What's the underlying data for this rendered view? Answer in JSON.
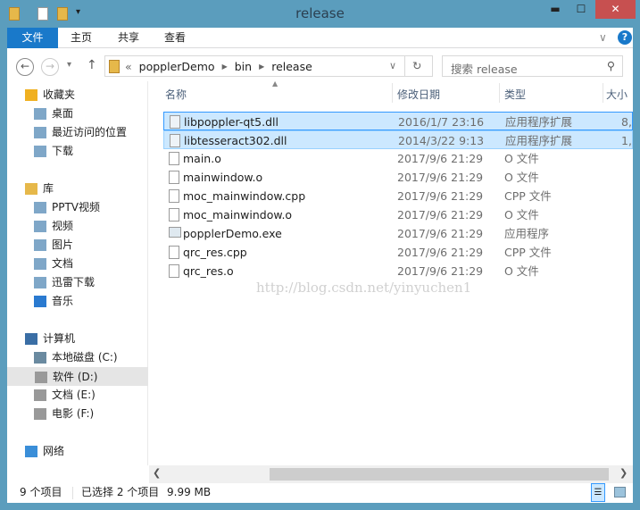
{
  "window": {
    "title": "release",
    "minimize": "▬",
    "maximize": "☐",
    "close": "✕"
  },
  "ribbon": {
    "tabs": [
      "文件",
      "主页",
      "共享",
      "查看"
    ],
    "expand": "∨",
    "help": "?"
  },
  "address": {
    "back": "←",
    "forward": "→",
    "recent": "▾",
    "up": "↑",
    "overflow": "«",
    "crumbs": [
      "popplerDemo",
      "bin",
      "release"
    ],
    "dropdown": "∨",
    "refresh": "↻"
  },
  "search": {
    "placeholder": "搜索 release",
    "icon": "search-icon"
  },
  "nav": [
    {
      "label": "收藏夹",
      "icon": "star-icon",
      "level": 0
    },
    {
      "label": "桌面",
      "icon": "desktop-icon",
      "level": 1
    },
    {
      "label": "最近访问的位置",
      "icon": "recent-places-icon",
      "level": 1
    },
    {
      "label": "下载",
      "icon": "downloads-folder-icon",
      "level": 1
    },
    {
      "label": "库",
      "icon": "library-icon",
      "level": 0
    },
    {
      "label": "PPTV视频",
      "icon": "library-video-icon",
      "level": 1
    },
    {
      "label": "视频",
      "icon": "video-icon",
      "level": 1
    },
    {
      "label": "图片",
      "icon": "pictures-icon",
      "level": 1
    },
    {
      "label": "文档",
      "icon": "documents-icon",
      "level": 1
    },
    {
      "label": "迅雷下载",
      "icon": "library-downloads-icon",
      "level": 1
    },
    {
      "label": "音乐",
      "icon": "music-icon",
      "level": 1
    },
    {
      "label": "计算机",
      "icon": "computer-icon",
      "level": 0
    },
    {
      "label": "本地磁盘 (C:)",
      "icon": "system-drive-icon",
      "level": 1
    },
    {
      "label": "软件 (D:)",
      "icon": "drive-icon",
      "level": 1,
      "selected": true
    },
    {
      "label": "文档 (E:)",
      "icon": "drive-icon",
      "level": 1
    },
    {
      "label": "电影 (F:)",
      "icon": "drive-icon",
      "level": 1
    },
    {
      "label": "网络",
      "icon": "network-icon",
      "level": 0
    }
  ],
  "columns": [
    "名称",
    "修改日期",
    "类型",
    "大小"
  ],
  "files": [
    {
      "name": "libpoppler-qt5.dll",
      "date": "2016/1/7 23:16",
      "type": "应用程序扩展",
      "size": "8,",
      "selected": true,
      "icon": "dll-icon"
    },
    {
      "name": "libtesseract302.dll",
      "date": "2014/3/22 9:13",
      "type": "应用程序扩展",
      "size": "1,",
      "selected": true,
      "icon": "dll-icon"
    },
    {
      "name": "main.o",
      "date": "2017/9/6 21:29",
      "type": "O 文件",
      "size": "",
      "icon": "file-icon"
    },
    {
      "name": "mainwindow.o",
      "date": "2017/9/6 21:29",
      "type": "O 文件",
      "size": "",
      "icon": "file-icon"
    },
    {
      "name": "moc_mainwindow.cpp",
      "date": "2017/9/6 21:29",
      "type": "CPP 文件",
      "size": "",
      "icon": "file-icon"
    },
    {
      "name": "moc_mainwindow.o",
      "date": "2017/9/6 21:29",
      "type": "O 文件",
      "size": "",
      "icon": "file-icon"
    },
    {
      "name": "popplerDemo.exe",
      "date": "2017/9/6 21:29",
      "type": "应用程序",
      "size": "",
      "icon": "exe-icon"
    },
    {
      "name": "qrc_res.cpp",
      "date": "2017/9/6 21:29",
      "type": "CPP 文件",
      "size": "",
      "icon": "file-icon"
    },
    {
      "name": "qrc_res.o",
      "date": "2017/9/6 21:29",
      "type": "O 文件",
      "size": "",
      "icon": "file-icon"
    }
  ],
  "watermark": "http://blog.csdn.net/yinyuchen1",
  "status": {
    "count": "9 个项目",
    "selected": "已选择 2 个项目",
    "size": "9.99 MB"
  },
  "colors": {
    "frame": "#5b9dbd",
    "file_tab": "#1979ca",
    "selection": "#cce8ff",
    "close": "#c75050"
  }
}
